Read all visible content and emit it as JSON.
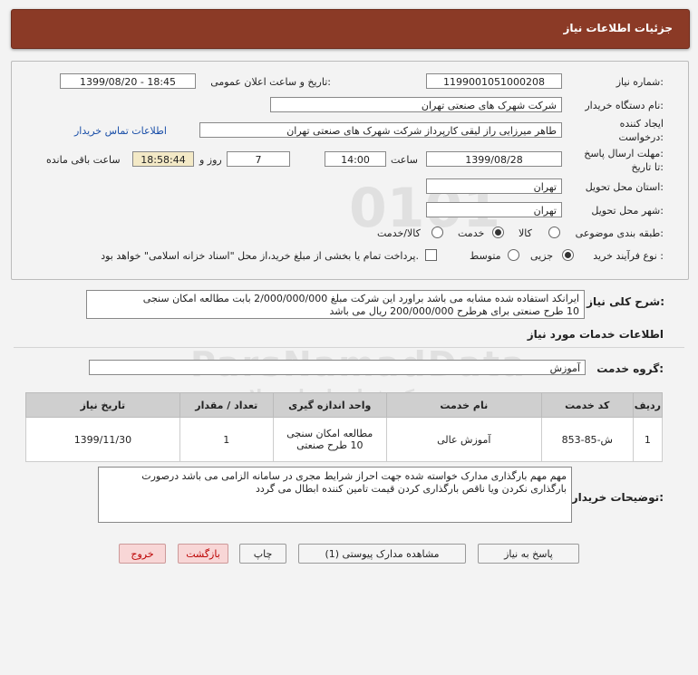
{
  "header": {
    "title": "جزئیات اطلاعات نیاز"
  },
  "fields": {
    "need_number_label": "شماره نیاز:",
    "need_number": "1199001051000208",
    "announce_label": "تاریخ و ساعت اعلان عمومی:",
    "announce_value": "1399/08/20 - 18:45",
    "buyer_label": "نام دستگاه خریدار:",
    "buyer_value": "شرکت شهرک های صنعتی تهران",
    "creator_label_1": "ایجاد کننده",
    "creator_label_2": "درخواست:",
    "creator_value": "طاهر  میرزایی راز لیقی کارپرداز  شرکت شهرک های صنعتی تهران",
    "contact_link": "اطلاعات تماس خریدار",
    "deadline_label_1": "مهلت ارسال پاسخ:",
    "deadline_label_2": "تا تاریخ:",
    "deadline_date": "1399/08/28",
    "time_label": "ساعت",
    "deadline_time": "14:00",
    "days_value": "7",
    "days_label": "روز و",
    "remaining_time": "18:58:44",
    "remaining_label": "ساعت باقی مانده",
    "province_label": "استان محل تحویل:",
    "province_value": "تهران",
    "city_label": "شهر محل تحویل:",
    "city_value": "تهران",
    "category_label": "طبقه بندی موضوعی:",
    "cat_goods": "کالا",
    "cat_service": "خدمت",
    "cat_goods_service": "کالا/خدمت",
    "category_selected": "خدمت",
    "purchase_label": "نوع فرآیند خرید :",
    "proc_minor": "جزیی",
    "proc_medium": "متوسط",
    "payment_note": "پرداخت تمام یا بخشی از مبلغ خرید،از محل \"اسناد خزانه اسلامی\" خواهد بود.",
    "process_selected": "جزیی"
  },
  "description": {
    "label": "شرح کلی نیاز:",
    "line1": "ایرانکد استفاده شده مشابه می باشد براورد این شرکت مبلغ 2/000/000/000  بابت مطالعه امکان سنجی",
    "line2": "10 طرح صنعتی برای هرطرح 200/000/000 ریال می باشد"
  },
  "services": {
    "section_title": "اطلاعات خدمات مورد نیاز",
    "group_label": "گروه خدمت:",
    "group_value": "آموزش",
    "columns": [
      "ردیف",
      "کد خدمت",
      "نام خدمت",
      "واحد اندازه گیری",
      "تعداد / مقدار",
      "تاریخ نیاز"
    ],
    "rows": [
      {
        "row": "1",
        "code": "ش-85-853",
        "name": "آموزش عالی",
        "unit": "مطالعه امکان سنجی 10 طرح صنعتی",
        "qty": "1",
        "date": "1399/11/30"
      }
    ]
  },
  "buyer_notes": {
    "label": "توضیحات خریدار:",
    "text": "مهم مهم بارگذاری مدارک خواسته شده جهت احراز شرایط مجری در سامانه الزامی می باشد درصورت بارگذاری نکردن ویا ناقص بارگذاری کردن قیمت تامین کننده ابطال می گردد"
  },
  "buttons": {
    "reply": "پاسخ به نیاز",
    "attachments": "مشاهده مدارک پیوستی (1)",
    "print": "چاپ",
    "back": "بازگشت",
    "exit": "خروج"
  },
  "watermark": {
    "brand": "ParsNamadData",
    "line1": "مرکز فراخوان استعلام",
    "line2": "پایگاه اطلاع رسانی مناقصات و مزایده",
    "number": "0101"
  }
}
